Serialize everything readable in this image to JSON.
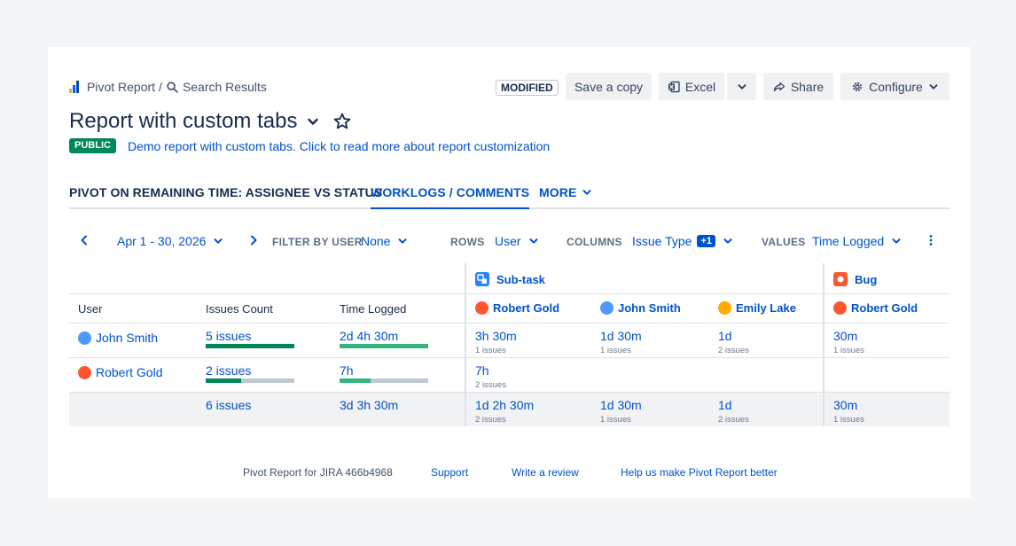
{
  "breadcrumb": {
    "root": "Pivot Report",
    "separator": "/",
    "current": "Search Results"
  },
  "header": {
    "status": "MODIFIED",
    "save_copy": "Save a copy",
    "excel": "Excel",
    "share": "Share",
    "configure": "Configure"
  },
  "report": {
    "title": "Report with custom tabs",
    "visibility": "PUBLIC",
    "description": "Demo report with custom tabs. Click to read more about report customization"
  },
  "tabs": [
    {
      "label": "PIVOT ON REMAINING TIME: ASSIGNEE VS STATUS"
    },
    {
      "label": "WORKLOGS / COMMENTS"
    },
    {
      "label": "MORE"
    }
  ],
  "filters": {
    "date_range": "Apr 1 - 30, 2026",
    "filter_by_user_label": "FILTER BY USER",
    "filter_by_user_value": "None",
    "rows_label": "ROWS",
    "rows_value": "User",
    "columns_label": "COLUMNS",
    "columns_value": "Issue Type",
    "columns_badge": "+1",
    "values_label": "VALUES",
    "values_value": "Time Logged"
  },
  "table": {
    "headers": {
      "user": "User",
      "issues_count": "Issues Count",
      "time_logged": "Time Logged"
    },
    "groups": [
      {
        "name": "Sub-task",
        "color": "#2684ff"
      },
      {
        "name": "Bug",
        "color": "#ff5630"
      }
    ],
    "column_people": [
      "Robert Gold",
      "John Smith",
      "Emily Lake",
      "Robert Gold"
    ],
    "rows": [
      {
        "user": "John Smith",
        "issues": "5 issues",
        "issues_fraction": 1.0,
        "time": "2d 4h 30m",
        "time_fraction": 1.0,
        "cells": [
          {
            "value": "3h 30m",
            "sub": "1 issues"
          },
          {
            "value": "1d 30m",
            "sub": "1 issues"
          },
          {
            "value": "1d",
            "sub": "2 issues"
          },
          {
            "value": "30m",
            "sub": "1 issues"
          }
        ]
      },
      {
        "user": "Robert Gold",
        "issues": "2 issues",
        "issues_fraction": 0.4,
        "time": "7h",
        "time_fraction": 0.35,
        "cells": [
          {
            "value": "7h",
            "sub": "2 issues"
          },
          {
            "value": "",
            "sub": ""
          },
          {
            "value": "",
            "sub": ""
          },
          {
            "value": "",
            "sub": ""
          }
        ]
      }
    ],
    "totals": {
      "issues": "6 issues",
      "time": "3d 3h 30m",
      "cells": [
        {
          "value": "1d 2h 30m",
          "sub": "2 issues"
        },
        {
          "value": "1d 30m",
          "sub": "1 issues"
        },
        {
          "value": "1d",
          "sub": "2 issues"
        },
        {
          "value": "30m",
          "sub": "1 issues"
        }
      ]
    }
  },
  "footer": {
    "version": "Pivot Report for JIRA 466b4968",
    "support": "Support",
    "review": "Write a review",
    "feedback": "Help us make Pivot Report better"
  },
  "colors": {
    "accent": "#0052cc",
    "public": "#00875a",
    "bar_dark": "#00875a",
    "bar_light": "#36b37e",
    "bar_track": "#c1c7d0"
  }
}
